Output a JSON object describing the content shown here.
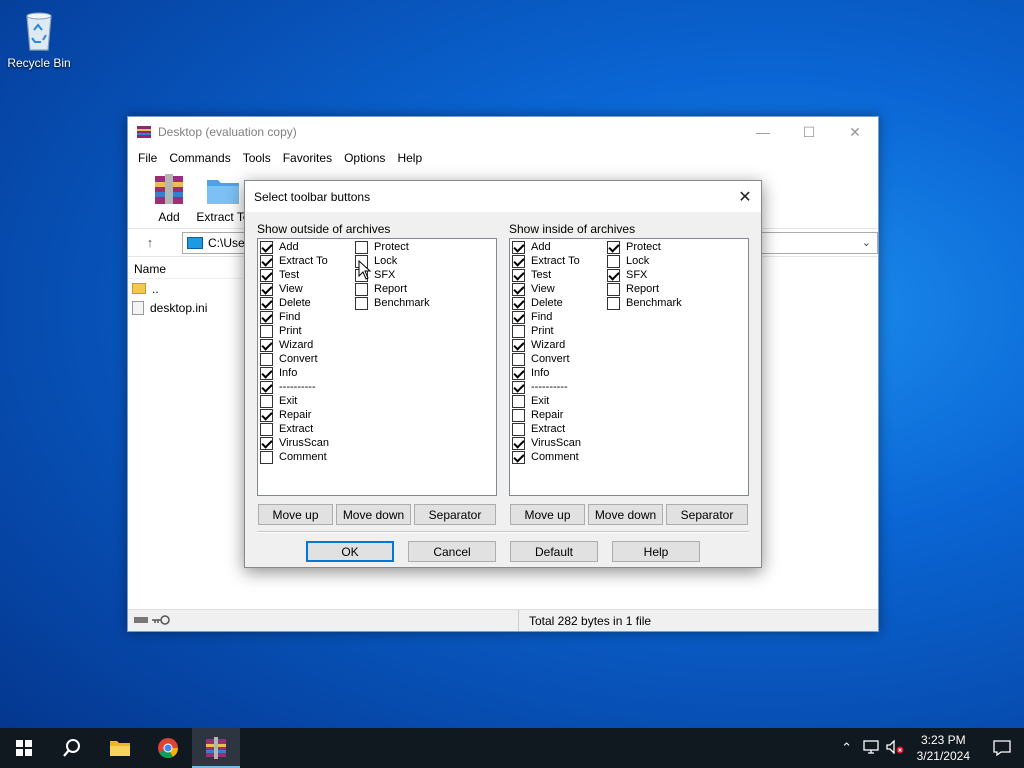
{
  "desktop": {
    "recycle_bin_label": "Recycle Bin"
  },
  "main_window": {
    "title": "Desktop (evaluation copy)",
    "menu": [
      "File",
      "Commands",
      "Tools",
      "Favorites",
      "Options",
      "Help"
    ],
    "toolbar": {
      "add_label": "Add",
      "extract_to_label": "Extract To"
    },
    "address": "C:\\User",
    "filelist": {
      "name_header": "Name",
      "rows": [
        "..",
        "desktop.ini"
      ]
    },
    "status_text": "Total 282 bytes in 1 file"
  },
  "dialog": {
    "title": "Select toolbar buttons",
    "outside": {
      "label": "Show outside of archives",
      "col1": [
        {
          "label": "Add",
          "checked": true
        },
        {
          "label": "Extract To",
          "checked": true
        },
        {
          "label": "Test",
          "checked": true
        },
        {
          "label": "View",
          "checked": true
        },
        {
          "label": "Delete",
          "checked": true
        },
        {
          "label": "Find",
          "checked": true
        },
        {
          "label": "Print",
          "checked": false
        },
        {
          "label": "Wizard",
          "checked": true
        },
        {
          "label": "Convert",
          "checked": false
        },
        {
          "label": "Info",
          "checked": true
        },
        {
          "label": "----------",
          "checked": true
        },
        {
          "label": "Exit",
          "checked": false
        },
        {
          "label": "Repair",
          "checked": true
        },
        {
          "label": "Extract",
          "checked": false
        },
        {
          "label": "VirusScan",
          "checked": true
        },
        {
          "label": "Comment",
          "checked": false
        }
      ],
      "col2": [
        {
          "label": "Protect",
          "checked": false
        },
        {
          "label": "Lock",
          "checked": false
        },
        {
          "label": "SFX",
          "checked": false
        },
        {
          "label": "Report",
          "checked": false
        },
        {
          "label": "Benchmark",
          "checked": false
        }
      ]
    },
    "inside": {
      "label": "Show inside of archives",
      "col1": [
        {
          "label": "Add",
          "checked": true
        },
        {
          "label": "Extract To",
          "checked": true
        },
        {
          "label": "Test",
          "checked": true
        },
        {
          "label": "View",
          "checked": true
        },
        {
          "label": "Delete",
          "checked": true
        },
        {
          "label": "Find",
          "checked": true
        },
        {
          "label": "Print",
          "checked": false
        },
        {
          "label": "Wizard",
          "checked": true
        },
        {
          "label": "Convert",
          "checked": false
        },
        {
          "label": "Info",
          "checked": true
        },
        {
          "label": "----------",
          "checked": true
        },
        {
          "label": "Exit",
          "checked": false
        },
        {
          "label": "Repair",
          "checked": false
        },
        {
          "label": "Extract",
          "checked": false
        },
        {
          "label": "VirusScan",
          "checked": true
        },
        {
          "label": "Comment",
          "checked": true
        }
      ],
      "col2": [
        {
          "label": "Protect",
          "checked": true
        },
        {
          "label": "Lock",
          "checked": false
        },
        {
          "label": "SFX",
          "checked": true
        },
        {
          "label": "Report",
          "checked": false
        },
        {
          "label": "Benchmark",
          "checked": false
        }
      ]
    },
    "buttons": {
      "move_up": "Move up",
      "move_down": "Move down",
      "separator": "Separator",
      "ok": "OK",
      "cancel": "Cancel",
      "default": "Default",
      "help": "Help"
    }
  },
  "taskbar": {
    "time": "3:23 PM",
    "date": "3/21/2024"
  },
  "colors": {
    "accent": "#0078d7",
    "taskbar": "#101820"
  }
}
